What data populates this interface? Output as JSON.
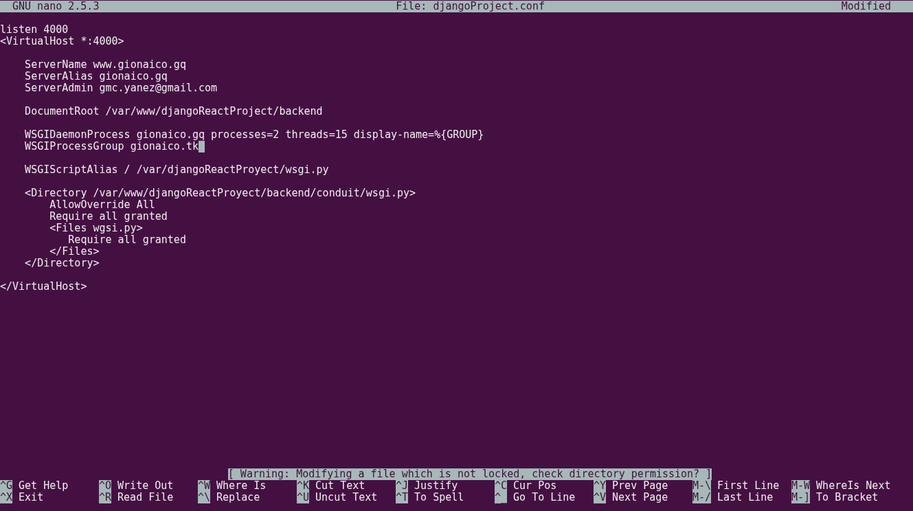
{
  "title_bar": {
    "app": "GNU nano 2.5.3",
    "file": "File: djangoProject.conf",
    "status": "Modified"
  },
  "lines": [
    {
      "text": "listen 4000",
      "cursor": false
    },
    {
      "text": "<VirtualHost *:4000>",
      "cursor": false
    },
    {
      "cursor": false
    },
    {
      "text": "    ServerName www.gionaico.gq",
      "cursor": false
    },
    {
      "text": "    ServerAlias gionaico.gq",
      "cursor": false
    },
    {
      "text": "    ServerAdmin gmc.yanez@gmail.com",
      "cursor": false
    },
    {
      "cursor": false
    },
    {
      "text": "    DocumentRoot /var/www/djangoReactProject/backend",
      "cursor": false
    },
    {
      "cursor": false
    },
    {
      "text": "    WSGIDaemonProcess gionaico.gq processes=2 threads=15 display-name=%{GROUP}",
      "cursor": false
    },
    {
      "text": "    WSGIProcessGroup gionaico.tk",
      "cursor": true
    },
    {
      "cursor": false
    },
    {
      "text": "    WSGIScriptAlias / /var/djangoReactProyect/wsgi.py",
      "cursor": false
    },
    {
      "cursor": false
    },
    {
      "text": "    <Directory /var/www/djangoReactProyect/backend/conduit/wsgi.py>",
      "cursor": false
    },
    {
      "text": "        AllowOverride All",
      "cursor": false
    },
    {
      "text": "        Require all granted",
      "cursor": false
    },
    {
      "text": "        <Files wgsi.py>",
      "cursor": false
    },
    {
      "text": "           Require all granted",
      "cursor": false
    },
    {
      "text": "        </Files>",
      "cursor": false
    },
    {
      "text": "    </Directory>",
      "cursor": false
    },
    {
      "cursor": false
    },
    {
      "text": "</VirtualHost>",
      "cursor": false
    }
  ],
  "status_message": "[ Warning: Modifying a file which is not locked, check directory permission? ]",
  "shortcuts": [
    {
      "key": "^G",
      "label": "Get Help"
    },
    {
      "key": "^O",
      "label": "Write Out"
    },
    {
      "key": "^W",
      "label": "Where Is"
    },
    {
      "key": "^K",
      "label": "Cut Text"
    },
    {
      "key": "^J",
      "label": "Justify"
    },
    {
      "key": "^C",
      "label": "Cur Pos"
    },
    {
      "key": "^Y",
      "label": "Prev Page"
    },
    {
      "key": "M-\\",
      "label": "First Line"
    },
    {
      "key": "M-W",
      "label": "WhereIs Next"
    },
    {
      "key": "^X",
      "label": "Exit"
    },
    {
      "key": "^R",
      "label": "Read File"
    },
    {
      "key": "^\\",
      "label": "Replace"
    },
    {
      "key": "^U",
      "label": "Uncut Text"
    },
    {
      "key": "^T",
      "label": "To Spell"
    },
    {
      "key": "^_",
      "label": "Go To Line"
    },
    {
      "key": "^V",
      "label": "Next Page"
    },
    {
      "key": "M-/",
      "label": "Last Line"
    },
    {
      "key": "M-]",
      "label": "To Bracket"
    }
  ]
}
